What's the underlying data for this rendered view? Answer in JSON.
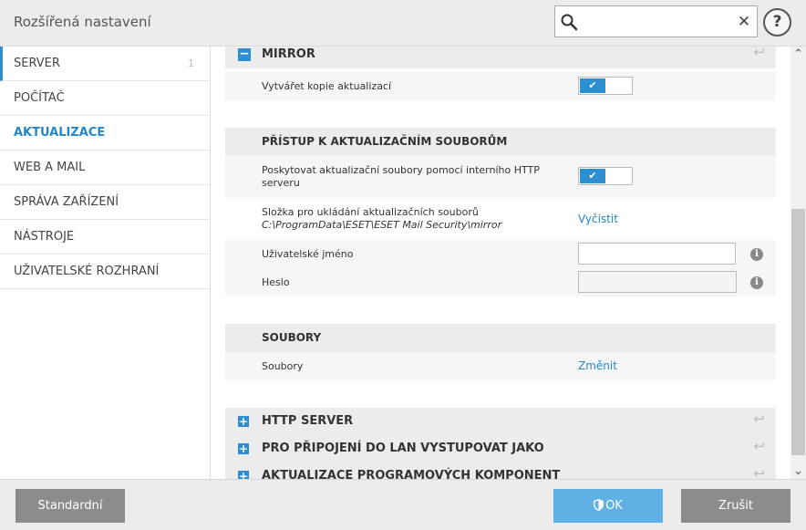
{
  "header": {
    "title": "Rozšířená nastavení",
    "search": {
      "value": "",
      "placeholder": ""
    },
    "clear_symbol": "✕",
    "help_symbol": "?"
  },
  "sidebar": {
    "items": [
      {
        "label": "SERVER",
        "count": "1"
      },
      {
        "label": "POČÍTAČ"
      },
      {
        "label": "AKTUALIZACE"
      },
      {
        "label": "WEB A MAIL"
      },
      {
        "label": "SPRÁVA ZAŘÍZENÍ"
      },
      {
        "label": "NÁSTROJE"
      },
      {
        "label": "UŽIVATELSKÉ ROZHRANÍ"
      }
    ],
    "active_index": 2
  },
  "content": {
    "mirror": {
      "title": "MIRROR",
      "create_copies_label": "Vytvářet kopie aktualizací",
      "create_copies_on": true
    },
    "access": {
      "title": "PŘÍSTUP K AKTUALIZAČNÍM SOUBORŮM",
      "provide_http_line1": "Poskytovat aktualizační soubory pomocí interního HTTP",
      "provide_http_line2": "serveru",
      "provide_http_on": true,
      "folder_label": "Složka pro ukládání aktualizačních souborů",
      "folder_path": "C:\\ProgramData\\ESET\\ESET Mail Security\\mirror",
      "folder_action": "Vyčistit",
      "username_label": "Uživatelské jméno",
      "username_value": "",
      "password_label": "Heslo",
      "password_value": ""
    },
    "files": {
      "title": "SOUBORY",
      "files_label": "Soubory",
      "files_action": "Změnit"
    },
    "collapsed_sections": [
      {
        "title": "HTTP SERVER"
      },
      {
        "title": "PRO PŘIPOJENÍ DO LAN VYSTUPOVAT JAKO"
      },
      {
        "title": "AKTUALIZACE PROGRAMOVÝCH KOMPONENT"
      }
    ],
    "expanded_symbol": "−",
    "collapsed_symbol": "+",
    "toggle_check": "✔",
    "info_symbol": "i",
    "undo_symbol": "↩"
  },
  "footer": {
    "standard_label": "Standardní",
    "ok_label": "OK",
    "cancel_label": "Zrušit"
  },
  "colors": {
    "accent": "#2b8fd1",
    "ok_button": "#5fb0e4",
    "grey_button": "#8c8c8c"
  }
}
